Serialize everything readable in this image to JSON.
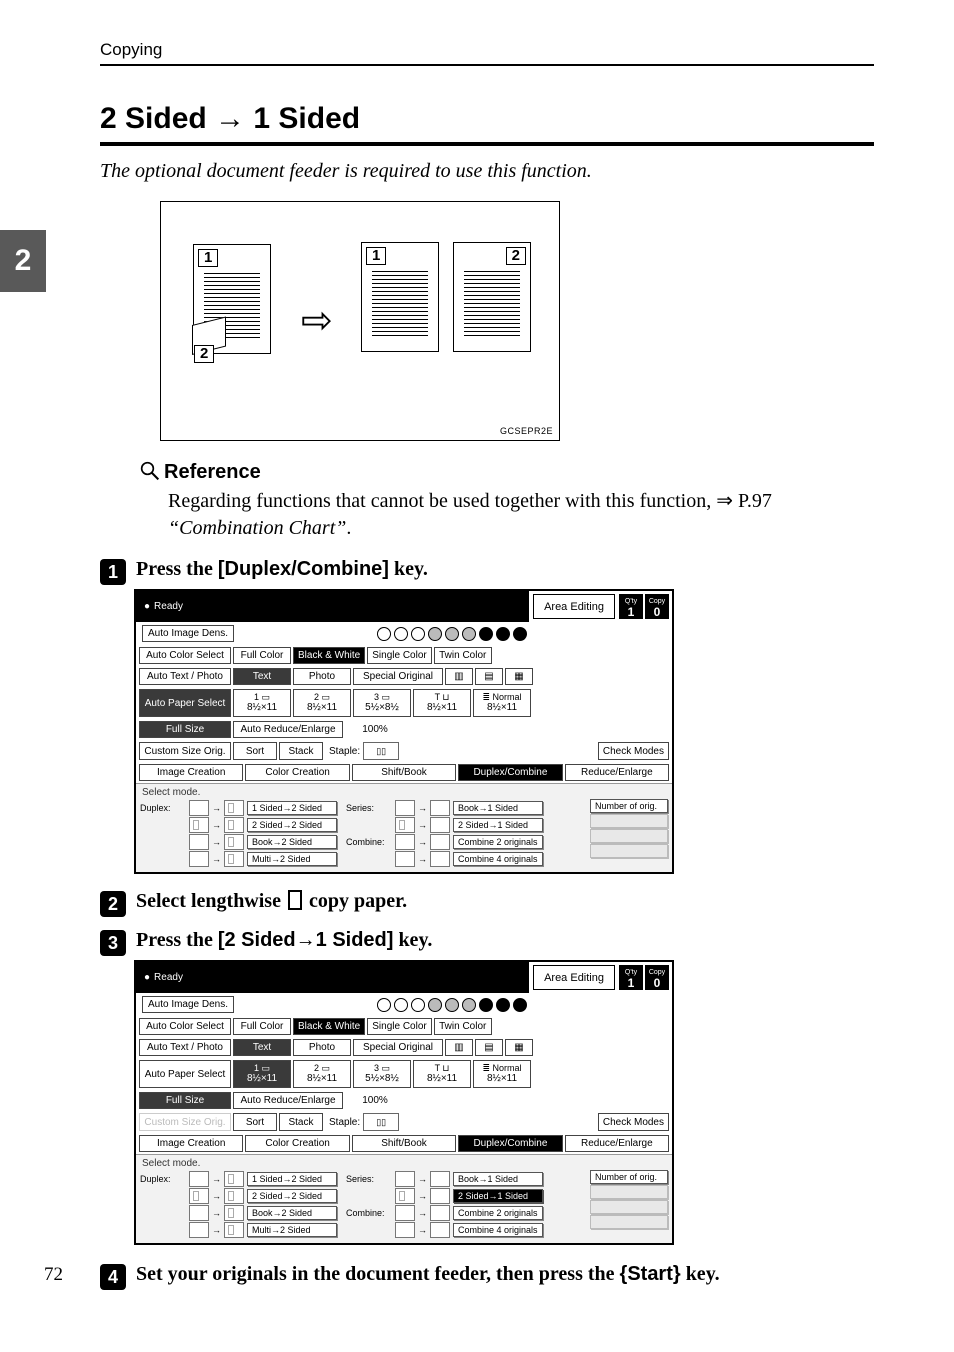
{
  "running_head": "Copying",
  "heading_pre": "2 Sided",
  "heading_post": "1 Sided",
  "subtitle": "The optional document feeder is required to use this function.",
  "side_tab": "2",
  "illus_id": "GCSEPR2E",
  "reference_label": "Reference",
  "reference_body_pre": "Regarding functions that cannot be used together with this function, ",
  "reference_arrow": "⇒",
  "reference_body_link": "P.97",
  "reference_body_post": "“Combination Chart”",
  "steps": {
    "s1_pre": "Press the ",
    "s1_key": "[Duplex/Combine]",
    "s1_post": " key.",
    "s2_pre": "Select lengthwise ",
    "s2_post": " copy paper.",
    "s3_pre": "Press the ",
    "s3_key": "[2 Sided→1 Sided]",
    "s3_post": " key.",
    "s4_pre": "Set your originals in the document feeder, then press the ",
    "s4_key_open": "{",
    "s4_key": "Start",
    "s4_key_close": "}",
    "s4_post": " key."
  },
  "page_number": "72",
  "panel": {
    "status": "Ready",
    "area_editing": "Area Editing",
    "qty_l": "Q'ty",
    "copy_l": "Copy",
    "qty_a": "1",
    "qty_b": "0",
    "auto_image_dens": "Auto Image Dens.",
    "color": {
      "auto": "Auto Color Select",
      "full": "Full Color",
      "bw": "Black & White",
      "single": "Single Color",
      "twin": "Twin Color"
    },
    "textphoto": {
      "auto": "Auto Text / Photo",
      "text": "Text",
      "photo": "Photo",
      "special": "Special Original"
    },
    "paper": {
      "auto": "Auto Paper Select",
      "t1": "8½×11",
      "t2": "8½×11",
      "t3": "5½×8½",
      "t4": "8½×11",
      "t5_top": "Normal",
      "t5": "8½×11"
    },
    "size": {
      "full": "Full Size",
      "auto": "Auto Reduce/Enlarge",
      "pct": "100%"
    },
    "row6": {
      "custom": "Custom Size Orig.",
      "sort": "Sort",
      "stack": "Stack",
      "staple": "Staple:",
      "check": "Check Modes"
    },
    "tabs": {
      "img": "Image Creation",
      "col": "Color Creation",
      "shift": "Shift/Book",
      "dup": "Duplex/Combine",
      "red": "Reduce/Enlarge"
    },
    "mode": {
      "title": "Select mode.",
      "duplex": "Duplex:",
      "series": "Series:",
      "combine": "Combine:",
      "d1": "1 Sided→2 Sided",
      "d2": "2 Sided→2 Sided",
      "d3": "Book→2 Sided",
      "d4": "Multi→2 Sided",
      "s1": "Book→1 Sided",
      "s2": "2 Sided→1 Sided",
      "c1": "Combine 2 originals",
      "c2": "Combine 4 originals",
      "num": "Number of orig."
    }
  }
}
